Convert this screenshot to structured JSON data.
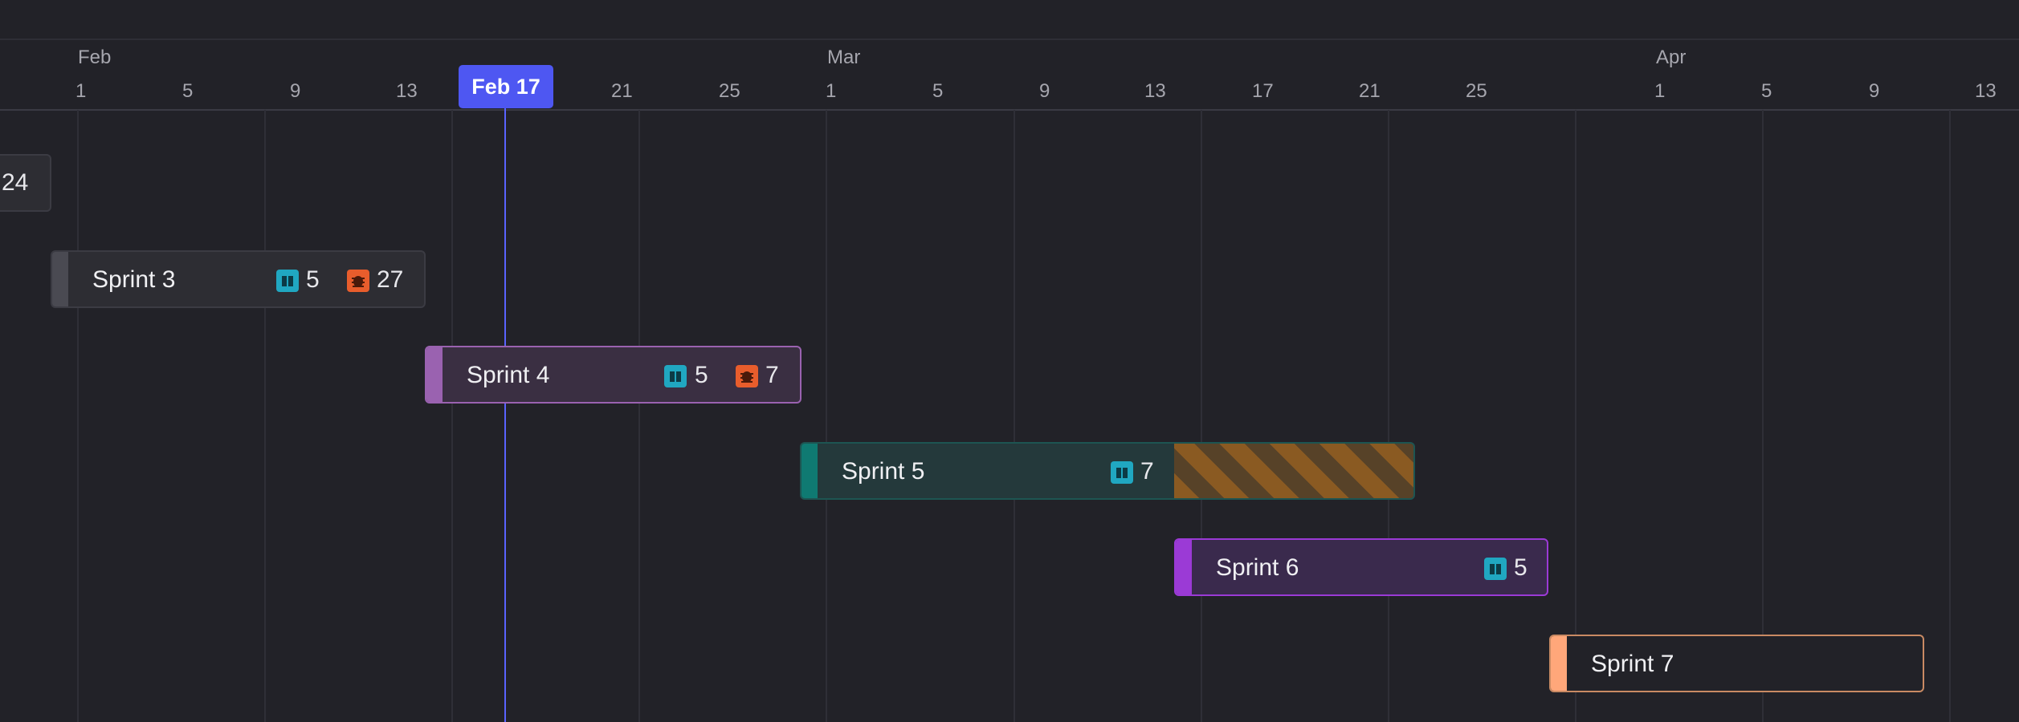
{
  "timeline": {
    "months": [
      {
        "label": "Feb"
      },
      {
        "label": "Mar"
      },
      {
        "label": "Apr"
      }
    ],
    "days": [
      "1",
      "5",
      "9",
      "13",
      "21",
      "25",
      "1",
      "5",
      "9",
      "13",
      "17",
      "21",
      "25",
      "1",
      "5",
      "9",
      "13"
    ],
    "today_label": "Feb 17"
  },
  "sprints": [
    {
      "name": "",
      "bug_count": "24"
    },
    {
      "name": "Sprint 3",
      "story_count": "5",
      "bug_count": "27"
    },
    {
      "name": "Sprint 4",
      "story_count": "5",
      "bug_count": "7"
    },
    {
      "name": "Sprint 5",
      "story_count": "7"
    },
    {
      "name": "Sprint 6",
      "story_count": "5"
    },
    {
      "name": "Sprint 7"
    }
  ],
  "colors": {
    "background": "#222228",
    "today": "#4e57f2",
    "story_icon": "#20a7c1",
    "bug_icon": "#e85d2c",
    "sprint3_accent": "#4a4a52",
    "sprint4_accent": "#9a62b0",
    "sprint5_accent": "#0f7a72",
    "sprint6_accent": "#9b3ad6",
    "sprint7_accent": "#ffa77a",
    "overdue_stripe": "#8a5a22"
  }
}
